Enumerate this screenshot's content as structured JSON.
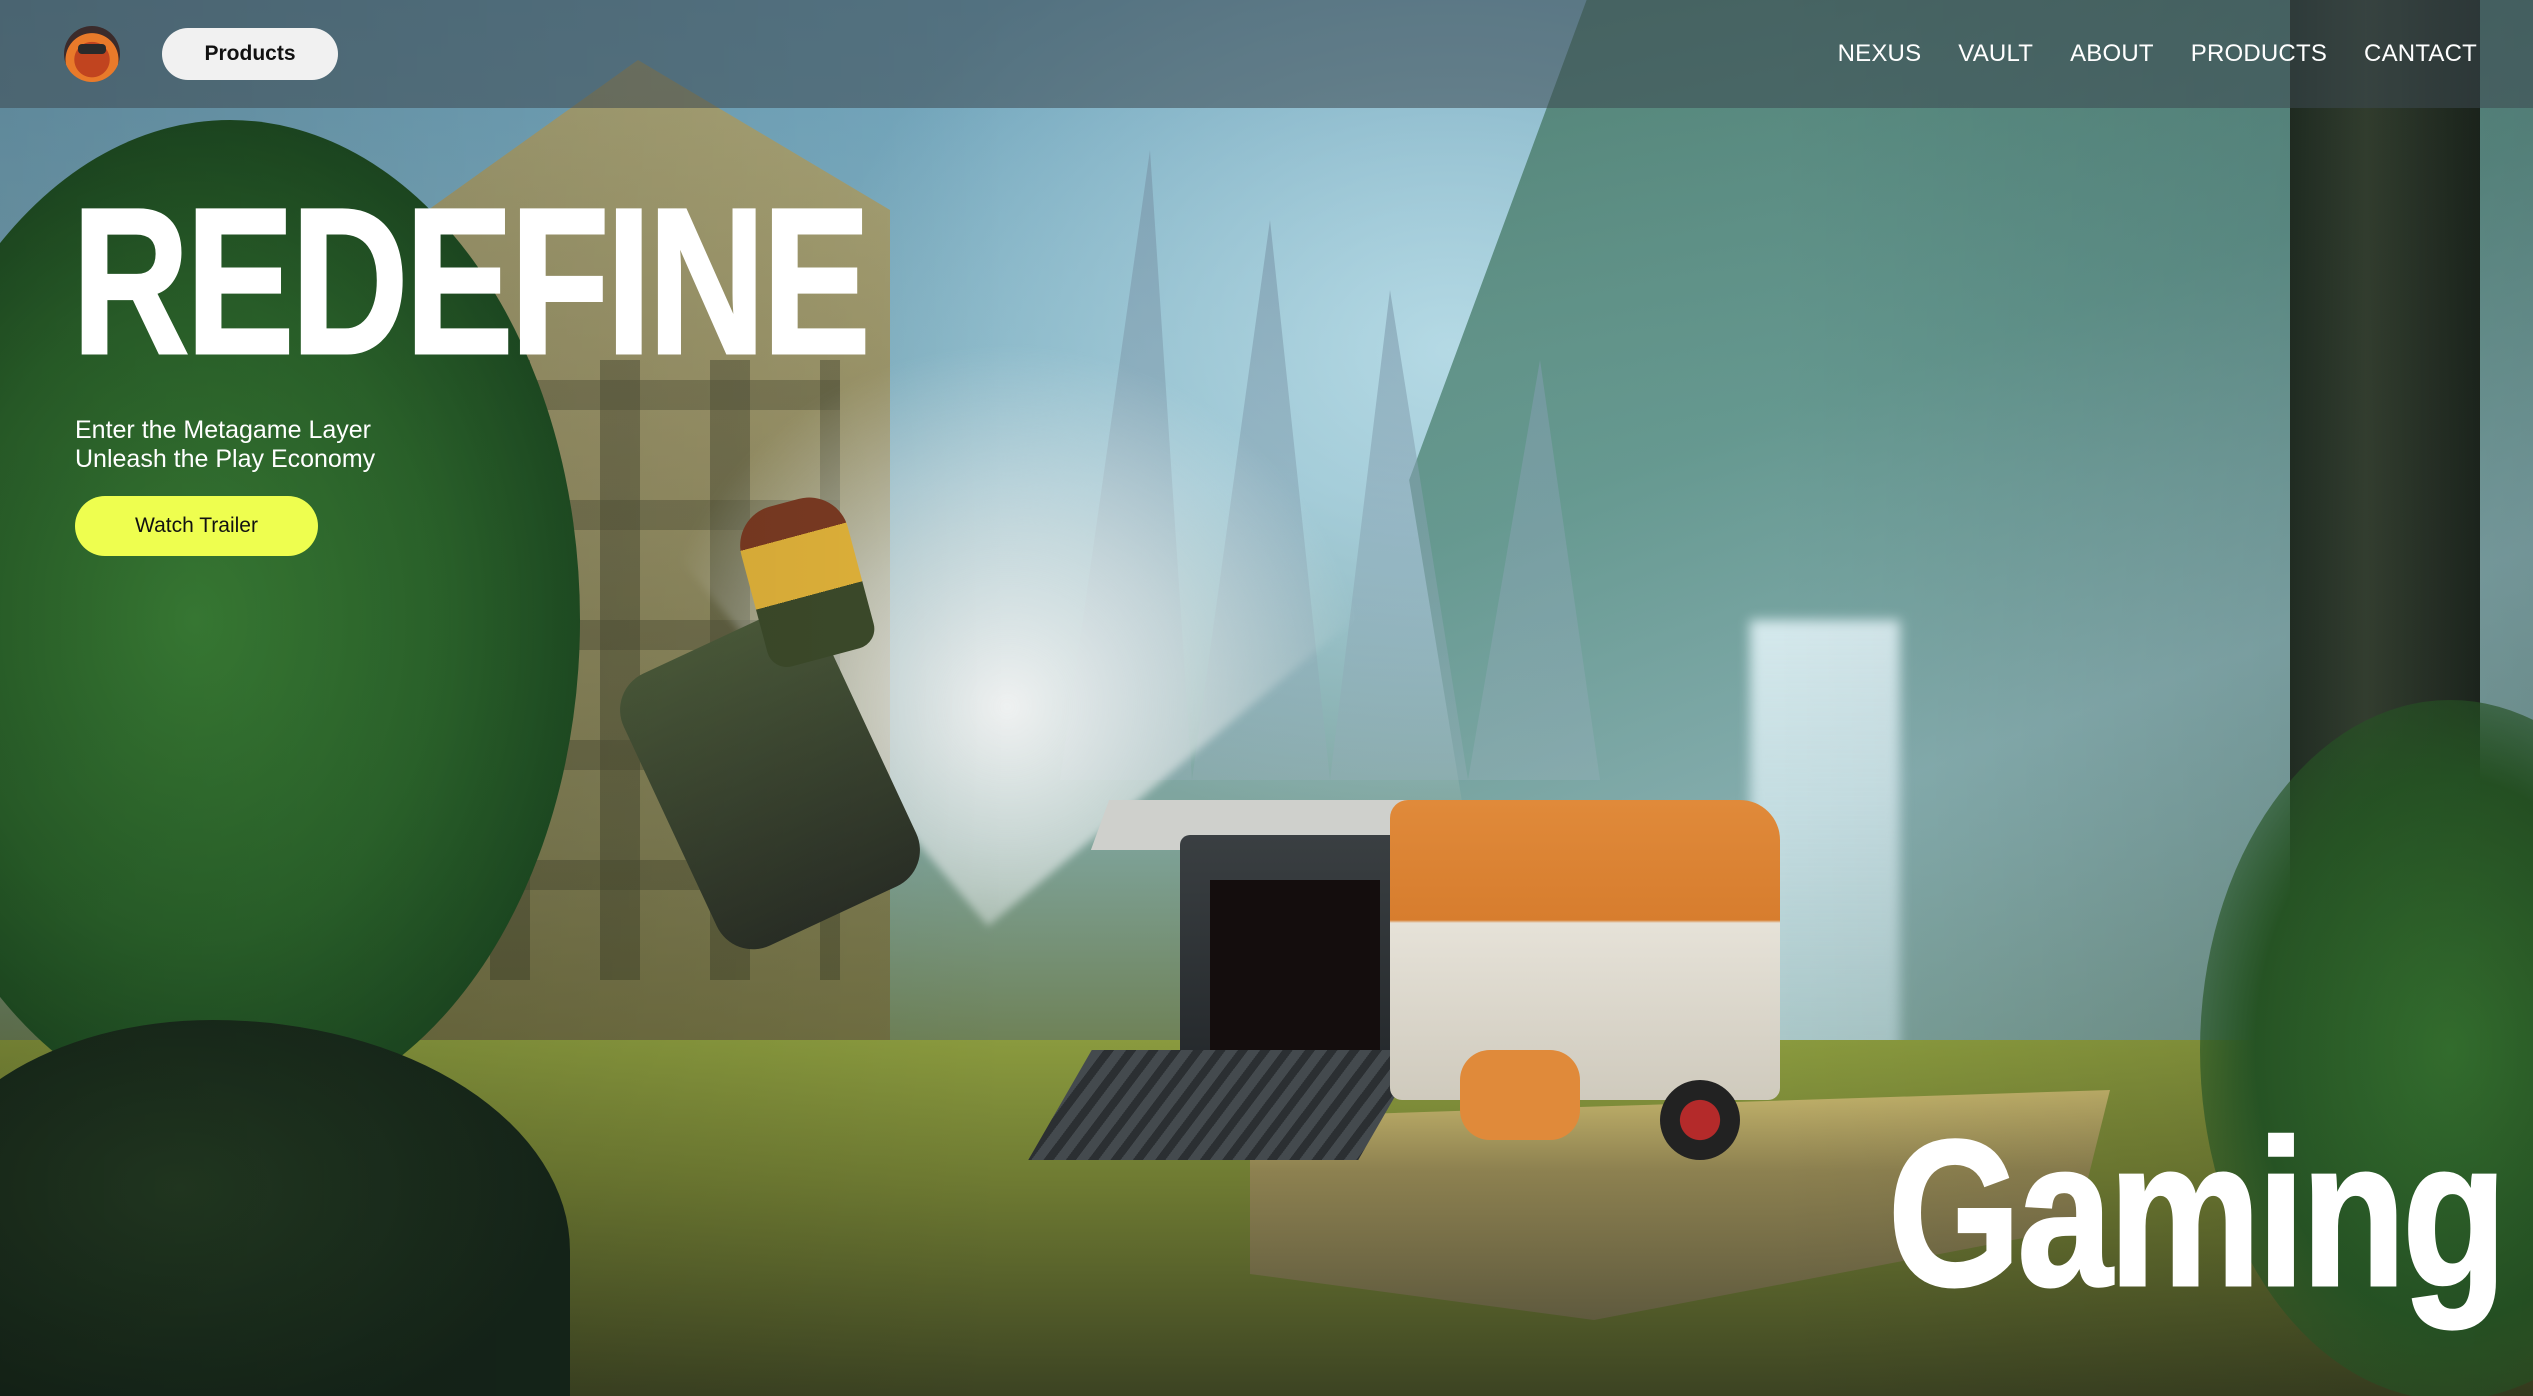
{
  "nav": {
    "products_label": "Products",
    "links": [
      "NEXUS",
      "VAULT",
      "ABOUT",
      "PRODUCTS",
      "CANTACT"
    ]
  },
  "hero": {
    "headline": "REDEFINE",
    "subtitle_line1": "Enter the Metagame Layer",
    "subtitle_line2": "Unleash the Play Economy",
    "cta_label": "Watch Trailer",
    "corner_word": "Gaming"
  },
  "colors": {
    "cta_background": "#eefe4f",
    "nav_background": "rgba(60,72,80,0.55)",
    "text": "#ffffff"
  },
  "icons": {
    "logo": "game-logo-icon"
  }
}
